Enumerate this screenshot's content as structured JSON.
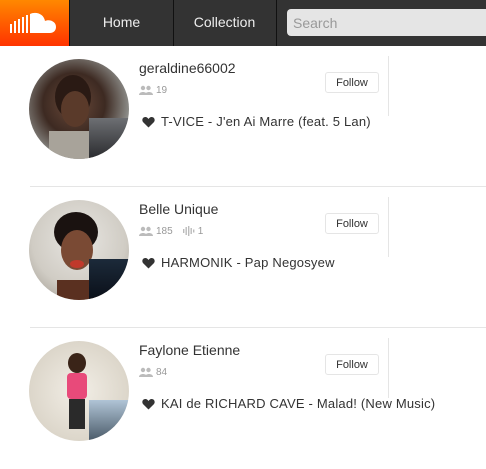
{
  "header": {
    "nav": [
      "Home",
      "Collection"
    ],
    "search_placeholder": "Search"
  },
  "users": [
    {
      "username": "geraldine66002",
      "followers": "19",
      "follow_label": "Follow",
      "liked_track": "T-VICE - J'en Ai Marre (feat. 5 Lan)"
    },
    {
      "username": "Belle Unique",
      "followers": "185",
      "tracks": "1",
      "follow_label": "Follow",
      "liked_track": "HARMONIK - Pap Negosyew"
    },
    {
      "username": "Faylone Etienne",
      "followers": "84",
      "follow_label": "Follow",
      "liked_track": "KAI de RICHARD CAVE - Malad! (New Music)"
    }
  ]
}
